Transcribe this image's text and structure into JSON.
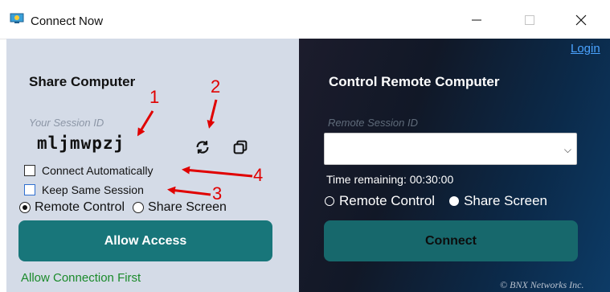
{
  "window": {
    "title": "Connect Now"
  },
  "share": {
    "heading": "Share Computer",
    "session_label": "Your Session ID",
    "session_id": "mljmwpzj",
    "connect_auto_label": "Connect Automatically",
    "keep_same_label": "Keep Same Session",
    "remote_control_label": "Remote Control",
    "share_screen_label": "Share Screen",
    "allow_label": "Allow Access",
    "status_text": "Allow Connection First"
  },
  "control": {
    "login_label": "Login",
    "heading": "Control Remote Computer",
    "remote_label": "Remote Session ID",
    "time_text": "Time remaining: 00:30:00",
    "remote_control_label": "Remote Control",
    "share_screen_label": "Share Screen",
    "connect_label": "Connect",
    "copyright": "© BNX Networks Inc."
  },
  "annotations": {
    "a1": "1",
    "a2": "2",
    "a3": "3",
    "a4": "4"
  },
  "colors": {
    "accent": "#18767a",
    "annotation": "#e00000",
    "status_green": "#1a8a2a",
    "link": "#4aa3ff"
  },
  "icons": [
    "app-icon",
    "minimize-icon",
    "maximize-icon",
    "close-icon",
    "refresh-icon",
    "copy-icon",
    "chevron-down-icon"
  ]
}
